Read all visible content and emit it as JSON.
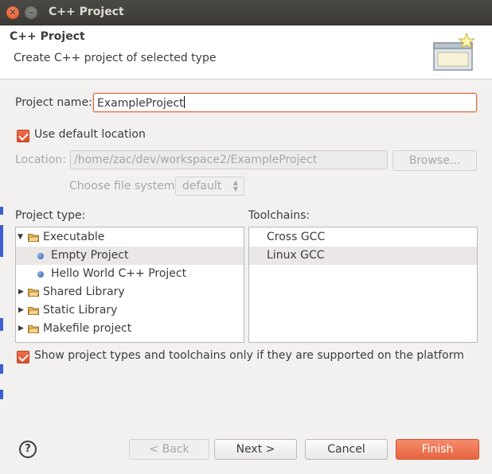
{
  "window": {
    "title": "C++ Project"
  },
  "banner": {
    "title": "C++ Project",
    "description": "Create C++ project of selected type"
  },
  "form": {
    "project_name_label": "Project name:",
    "project_name_value": "ExampleProject",
    "use_default_location_label": "Use default location",
    "use_default_location_checked": true,
    "location_label": "Location:",
    "location_value": "/home/zac/dev/workspace2/ExampleProject",
    "browse_label": "Browse...",
    "file_system_label": "Choose file system:",
    "file_system_value": "default"
  },
  "project_type": {
    "label": "Project type:",
    "items": [
      {
        "label": "Executable",
        "kind": "folder",
        "expanded": true
      },
      {
        "label": "Empty Project",
        "kind": "leaf",
        "selected": true
      },
      {
        "label": "Hello World C++ Project",
        "kind": "leaf"
      },
      {
        "label": "Shared Library",
        "kind": "folder",
        "expanded": false
      },
      {
        "label": "Static Library",
        "kind": "folder",
        "expanded": false
      },
      {
        "label": "Makefile project",
        "kind": "folder",
        "expanded": false
      }
    ]
  },
  "toolchains": {
    "label": "Toolchains:",
    "items": [
      {
        "label": "Cross GCC"
      },
      {
        "label": "Linux GCC",
        "selected": true
      }
    ]
  },
  "filter": {
    "label": "Show project types and toolchains only if they are supported on the platform",
    "checked": true
  },
  "buttons": {
    "help": "?",
    "back": "< Back",
    "next": "Next >",
    "cancel": "Cancel",
    "finish": "Finish"
  },
  "colors": {
    "accent": "#e95420",
    "titlebar": "#3c3b37",
    "selection": "#e9e8e6"
  }
}
